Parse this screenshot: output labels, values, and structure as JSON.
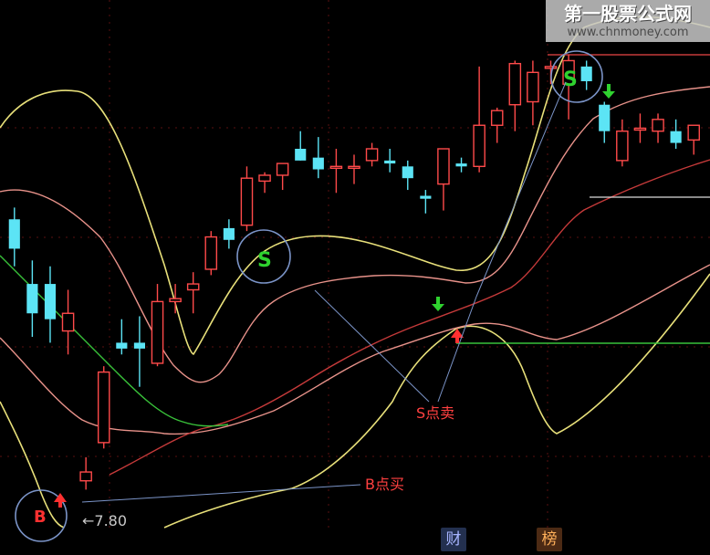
{
  "watermark": {
    "title": "第一股票公式网",
    "url": "www.chnmoney.com"
  },
  "tabs": [
    {
      "label": "财"
    },
    {
      "label": "榜"
    }
  ],
  "annotations": {
    "sell_label": "S点卖",
    "buy_label": "B点买",
    "s_mark": "S",
    "b_mark": "B",
    "low_price": "←7.80"
  },
  "colors": {
    "background": "#000000",
    "up_candle": "#ff4a4a",
    "down_candle": "#5ce4f5",
    "band_outer": "#e8e07a",
    "band_mid": "#e8928a",
    "band_inner": "#c53a3a",
    "ma_line": "#39c23a",
    "circle": "#7b94c8",
    "sell_arrow": "#2fd22f",
    "buy_arrow": "#ff3030",
    "label": "#ff4040"
  },
  "chart_data": {
    "type": "candlestick",
    "title": "",
    "xlabel": "",
    "ylabel": "",
    "grid": true,
    "x": [
      1,
      2,
      3,
      4,
      5,
      6,
      7,
      8,
      9,
      10,
      11,
      12,
      13,
      14,
      15,
      16,
      17,
      18,
      19,
      20,
      21,
      22,
      23,
      24,
      25,
      26,
      27,
      28,
      29,
      30,
      31,
      32,
      33,
      34,
      35,
      36,
      37,
      38,
      39
    ],
    "ylim": [
      7.2,
      15.2
    ],
    "candles": [
      {
        "o": 12.4,
        "h": 12.6,
        "l": 11.6,
        "c": 11.9
      },
      {
        "o": 11.3,
        "h": 11.7,
        "l": 10.4,
        "c": 10.8
      },
      {
        "o": 11.3,
        "h": 11.6,
        "l": 10.3,
        "c": 10.7
      },
      {
        "o": 10.5,
        "h": 11.2,
        "l": 10.1,
        "c": 10.8
      },
      {
        "o": 7.95,
        "h": 8.35,
        "l": 7.8,
        "c": 8.1
      },
      {
        "o": 8.6,
        "h": 9.9,
        "l": 8.5,
        "c": 9.8
      },
      {
        "o": 10.3,
        "h": 10.7,
        "l": 10.1,
        "c": 10.2
      },
      {
        "o": 10.3,
        "h": 10.75,
        "l": 9.55,
        "c": 10.2
      },
      {
        "o": 9.95,
        "h": 11.3,
        "l": 9.9,
        "c": 11.0
      },
      {
        "o": 11.0,
        "h": 11.3,
        "l": 10.8,
        "c": 11.05
      },
      {
        "o": 11.2,
        "h": 11.5,
        "l": 10.8,
        "c": 11.3
      },
      {
        "o": 11.55,
        "h": 12.2,
        "l": 11.45,
        "c": 12.1
      },
      {
        "o": 12.25,
        "h": 12.4,
        "l": 11.9,
        "c": 12.05
      },
      {
        "o": 12.3,
        "h": 13.3,
        "l": 12.2,
        "c": 13.1
      },
      {
        "o": 13.05,
        "h": 13.2,
        "l": 12.85,
        "c": 13.15
      },
      {
        "o": 13.15,
        "h": 13.3,
        "l": 12.9,
        "c": 13.35
      },
      {
        "o": 13.6,
        "h": 13.9,
        "l": 13.4,
        "c": 13.4
      },
      {
        "o": 13.45,
        "h": 13.8,
        "l": 13.1,
        "c": 13.25
      },
      {
        "o": 13.3,
        "h": 13.6,
        "l": 12.85,
        "c": 13.3
      },
      {
        "o": 13.3,
        "h": 13.5,
        "l": 13.0,
        "c": 13.3
      },
      {
        "o": 13.4,
        "h": 13.7,
        "l": 13.3,
        "c": 13.6
      },
      {
        "o": 13.4,
        "h": 13.6,
        "l": 13.2,
        "c": 13.35
      },
      {
        "o": 13.3,
        "h": 13.4,
        "l": 12.9,
        "c": 13.1
      },
      {
        "o": 12.8,
        "h": 12.9,
        "l": 12.5,
        "c": 12.75
      },
      {
        "o": 13.0,
        "h": 13.6,
        "l": 12.55,
        "c": 13.6
      },
      {
        "o": 13.35,
        "h": 13.45,
        "l": 13.2,
        "c": 13.3
      },
      {
        "o": 13.3,
        "h": 15.0,
        "l": 13.2,
        "c": 14.0
      },
      {
        "o": 14.0,
        "h": 14.3,
        "l": 13.7,
        "c": 14.25
      },
      {
        "o": 14.35,
        "h": 15.1,
        "l": 13.9,
        "c": 15.05
      },
      {
        "o": 14.4,
        "h": 15.1,
        "l": 14.0,
        "c": 14.9
      },
      {
        "o": 15.0,
        "h": 15.1,
        "l": 14.7,
        "c": 15.0
      },
      {
        "o": 14.7,
        "h": 15.2,
        "l": 14.1,
        "c": 15.1
      },
      {
        "o": 15.0,
        "h": 15.1,
        "l": 14.6,
        "c": 14.75
      },
      {
        "o": 14.35,
        "h": 14.4,
        "l": 13.7,
        "c": 13.9
      },
      {
        "o": 13.4,
        "h": 14.1,
        "l": 13.3,
        "c": 13.9
      },
      {
        "o": 13.95,
        "h": 14.2,
        "l": 13.7,
        "c": 13.95
      },
      {
        "o": 13.9,
        "h": 14.2,
        "l": 13.7,
        "c": 14.1
      },
      {
        "o": 13.9,
        "h": 14.1,
        "l": 13.6,
        "c": 13.7
      },
      {
        "o": 13.75,
        "h": 14.0,
        "l": 13.5,
        "c": 14.0
      }
    ]
  }
}
